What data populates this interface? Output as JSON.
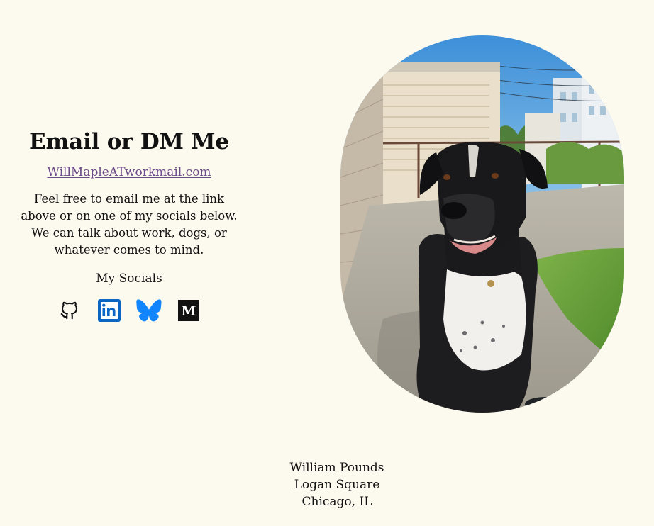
{
  "contact": {
    "heading": "Email or DM Me",
    "email_text": "WillMapleATworkmail.com",
    "blurb": "Feel free to email me at the link above or on one of my socials below. We can talk about work, dogs, or whatever comes to mind.",
    "socials_label": "My Socials",
    "socials": [
      {
        "name": "GitHub",
        "icon": "github-icon"
      },
      {
        "name": "LinkedIn",
        "icon": "linkedin-icon",
        "color": "#0a66c2"
      },
      {
        "name": "Bluesky",
        "icon": "bluesky-icon",
        "color": "#1185fe"
      },
      {
        "name": "Medium",
        "icon": "medium-icon"
      }
    ]
  },
  "photo": {
    "subject": "black-and-white-dog"
  },
  "footer": {
    "name": "William Pounds",
    "neighborhood": "Logan Square",
    "city": "Chicago, IL"
  },
  "colors": {
    "background": "#fcf9ef",
    "link": "#6b4a8a"
  }
}
